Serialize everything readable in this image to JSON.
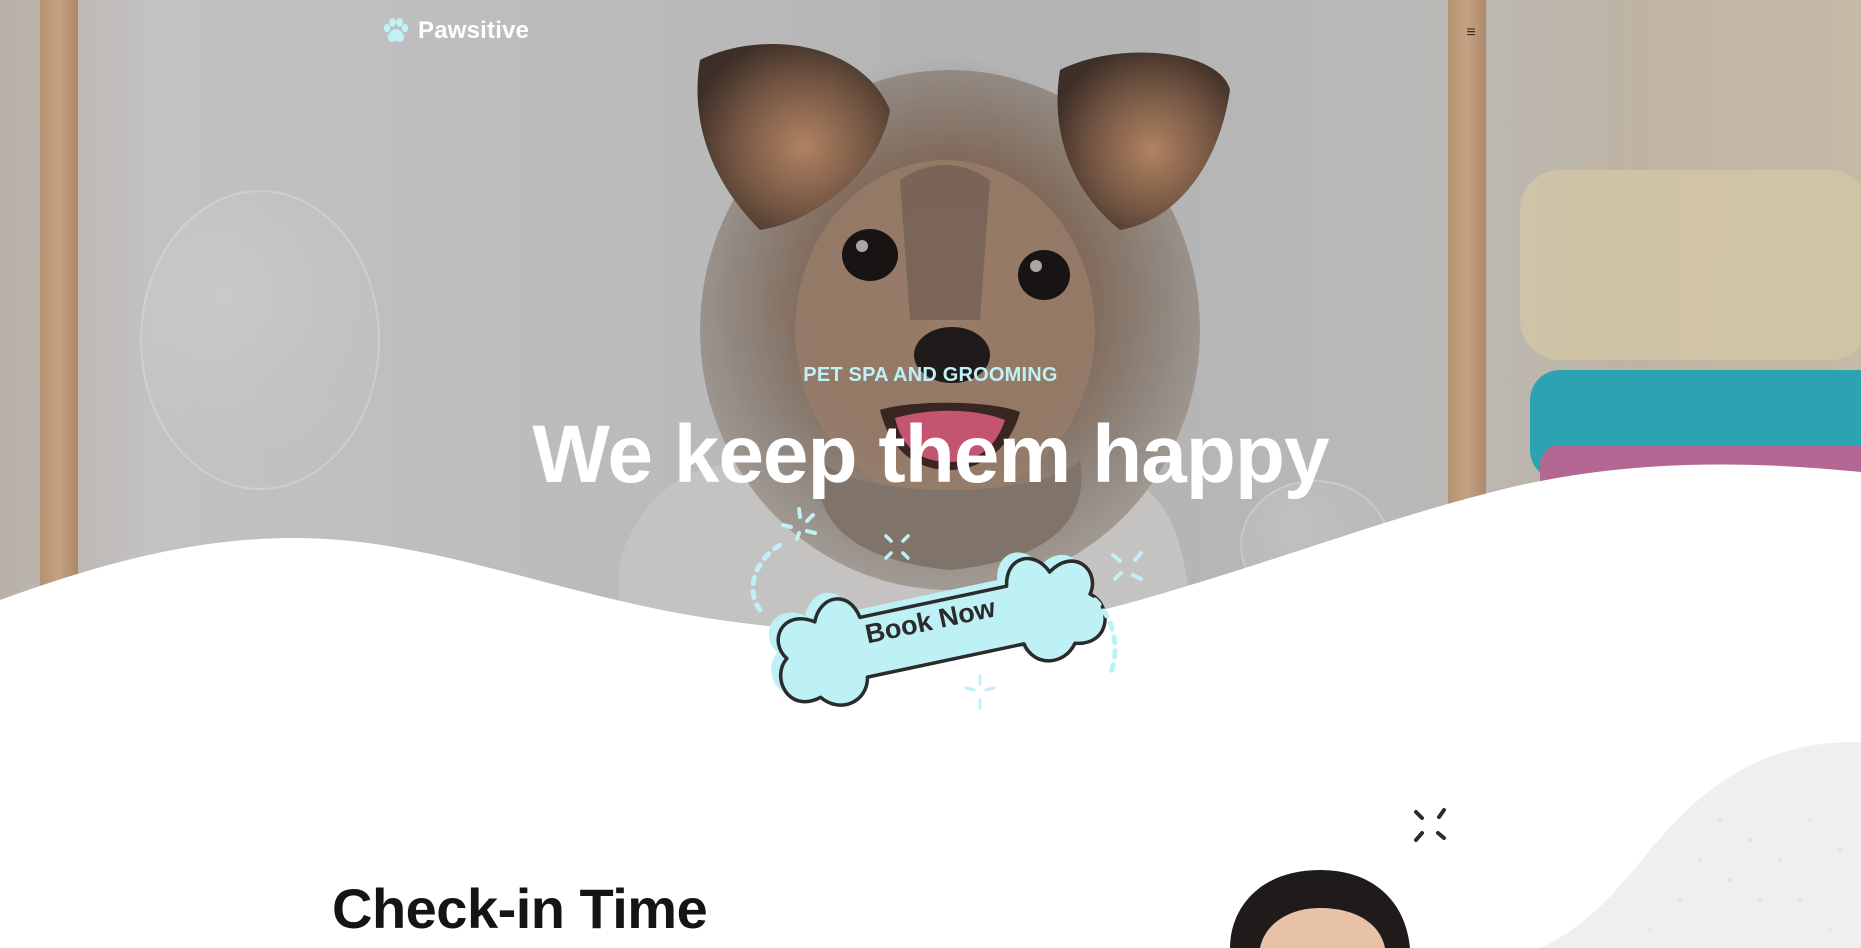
{
  "brand": {
    "name": "Pawsitive",
    "logo_icon": "paw-icon",
    "accent_color": "#bff1f6",
    "button_color": "#bef1f6",
    "outline_color": "#2b2b2b"
  },
  "nav": {
    "menu_icon": "hamburger-menu-icon",
    "menu_glyph": "≡"
  },
  "hero": {
    "eyebrow": "PET SPA AND GROOMING",
    "headline": "We keep them happy",
    "cta_label": "Book Now"
  },
  "checkin": {
    "title": "Check-in Time"
  }
}
